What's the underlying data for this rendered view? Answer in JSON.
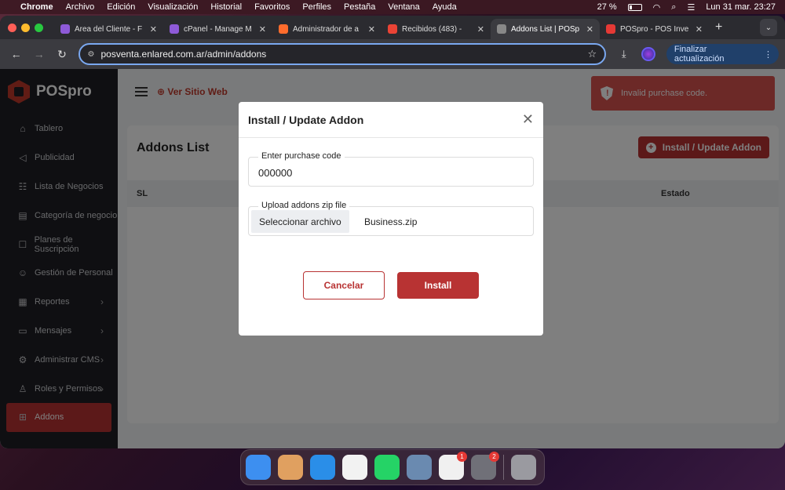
{
  "menubar": {
    "app": "Chrome",
    "items": [
      "Archivo",
      "Edición",
      "Visualización",
      "Historial",
      "Favoritos",
      "Perfiles",
      "Pestaña",
      "Ventana",
      "Ayuda"
    ],
    "battery": "27 %",
    "datetime": "Lun 31 mar.  23:27",
    "battery_level": 0.27
  },
  "tabs": [
    {
      "label": "Área del Cliente - F",
      "color": "#8e5ad8"
    },
    {
      "label": "cPanel - Manage M",
      "color": "#8e5ad8"
    },
    {
      "label": "Administrador de a",
      "color": "#ff6c2c"
    },
    {
      "label": "Recibidos (483) - ",
      "color": "#ea4335"
    },
    {
      "label": "Addons List | POSp",
      "color": "#888888"
    },
    {
      "label": "POSpro - POS Inve",
      "color": "#e53935"
    }
  ],
  "browser": {
    "url": "posventa.enlared.com.ar/admin/addons",
    "update_button": "Finalizar actualización"
  },
  "app": {
    "brand": "POSpro",
    "visit_site": "Ver Sitio Web",
    "sidebar": [
      {
        "label": "Tablero",
        "icon": "home-icon",
        "glyph": "⌂",
        "chevron": false
      },
      {
        "label": "Publicidad",
        "icon": "megaphone-icon",
        "glyph": "◁",
        "chevron": false
      },
      {
        "label": "Lista de Negocios",
        "icon": "list-icon",
        "glyph": "☷",
        "chevron": false
      },
      {
        "label": "Categoría de negocio",
        "icon": "category-icon",
        "glyph": "▤",
        "chevron": false
      },
      {
        "label": "Planes de Suscripción",
        "icon": "plan-icon",
        "glyph": "☐",
        "chevron": false
      },
      {
        "label": "Gestión de Personal",
        "icon": "people-icon",
        "glyph": "☺",
        "chevron": false
      },
      {
        "label": "Reportes",
        "icon": "report-icon",
        "glyph": "▦",
        "chevron": true
      },
      {
        "label": "Mensajes",
        "icon": "message-icon",
        "glyph": "▭",
        "chevron": true
      },
      {
        "label": "Administrar CMS",
        "icon": "gear-icon",
        "glyph": "⚙",
        "chevron": true
      },
      {
        "label": "Roles y Permisos",
        "icon": "roles-icon",
        "glyph": "♙",
        "chevron": true
      },
      {
        "label": "Addons",
        "icon": "addon-icon",
        "glyph": "⊞",
        "chevron": false
      }
    ],
    "page_title": "Addons List",
    "add_button": "Install / Update Addon",
    "table_headers": {
      "sl": "SL",
      "estado": "Estado"
    },
    "toast": "Invalid purchase code."
  },
  "modal": {
    "title": "Install / Update Addon",
    "purchase_label": "Enter purchase code",
    "purchase_value": "000000",
    "upload_label": "Upload addons zip file",
    "file_button": "Seleccionar archivo",
    "file_name": "Business.zip",
    "cancel": "Cancelar",
    "install": "Install"
  },
  "dock": [
    {
      "name": "finder-icon",
      "color": "#3d8ff0",
      "badge": ""
    },
    {
      "name": "launchpad-icon",
      "color": "#e0a060",
      "badge": ""
    },
    {
      "name": "safari-icon",
      "color": "#2a8ee8",
      "badge": ""
    },
    {
      "name": "chrome-icon",
      "color": "#f2f2f2",
      "badge": ""
    },
    {
      "name": "whatsapp-icon",
      "color": "#25d366",
      "badge": ""
    },
    {
      "name": "preview-icon",
      "color": "#6a8ab0",
      "badge": ""
    },
    {
      "name": "app-store-icon",
      "color": "#f0f0f0",
      "badge": "1"
    },
    {
      "name": "system-settings-icon",
      "color": "#707078",
      "badge": "2"
    },
    {
      "name": "trash-icon",
      "color": "#9a9aa0",
      "badge": ""
    }
  ]
}
